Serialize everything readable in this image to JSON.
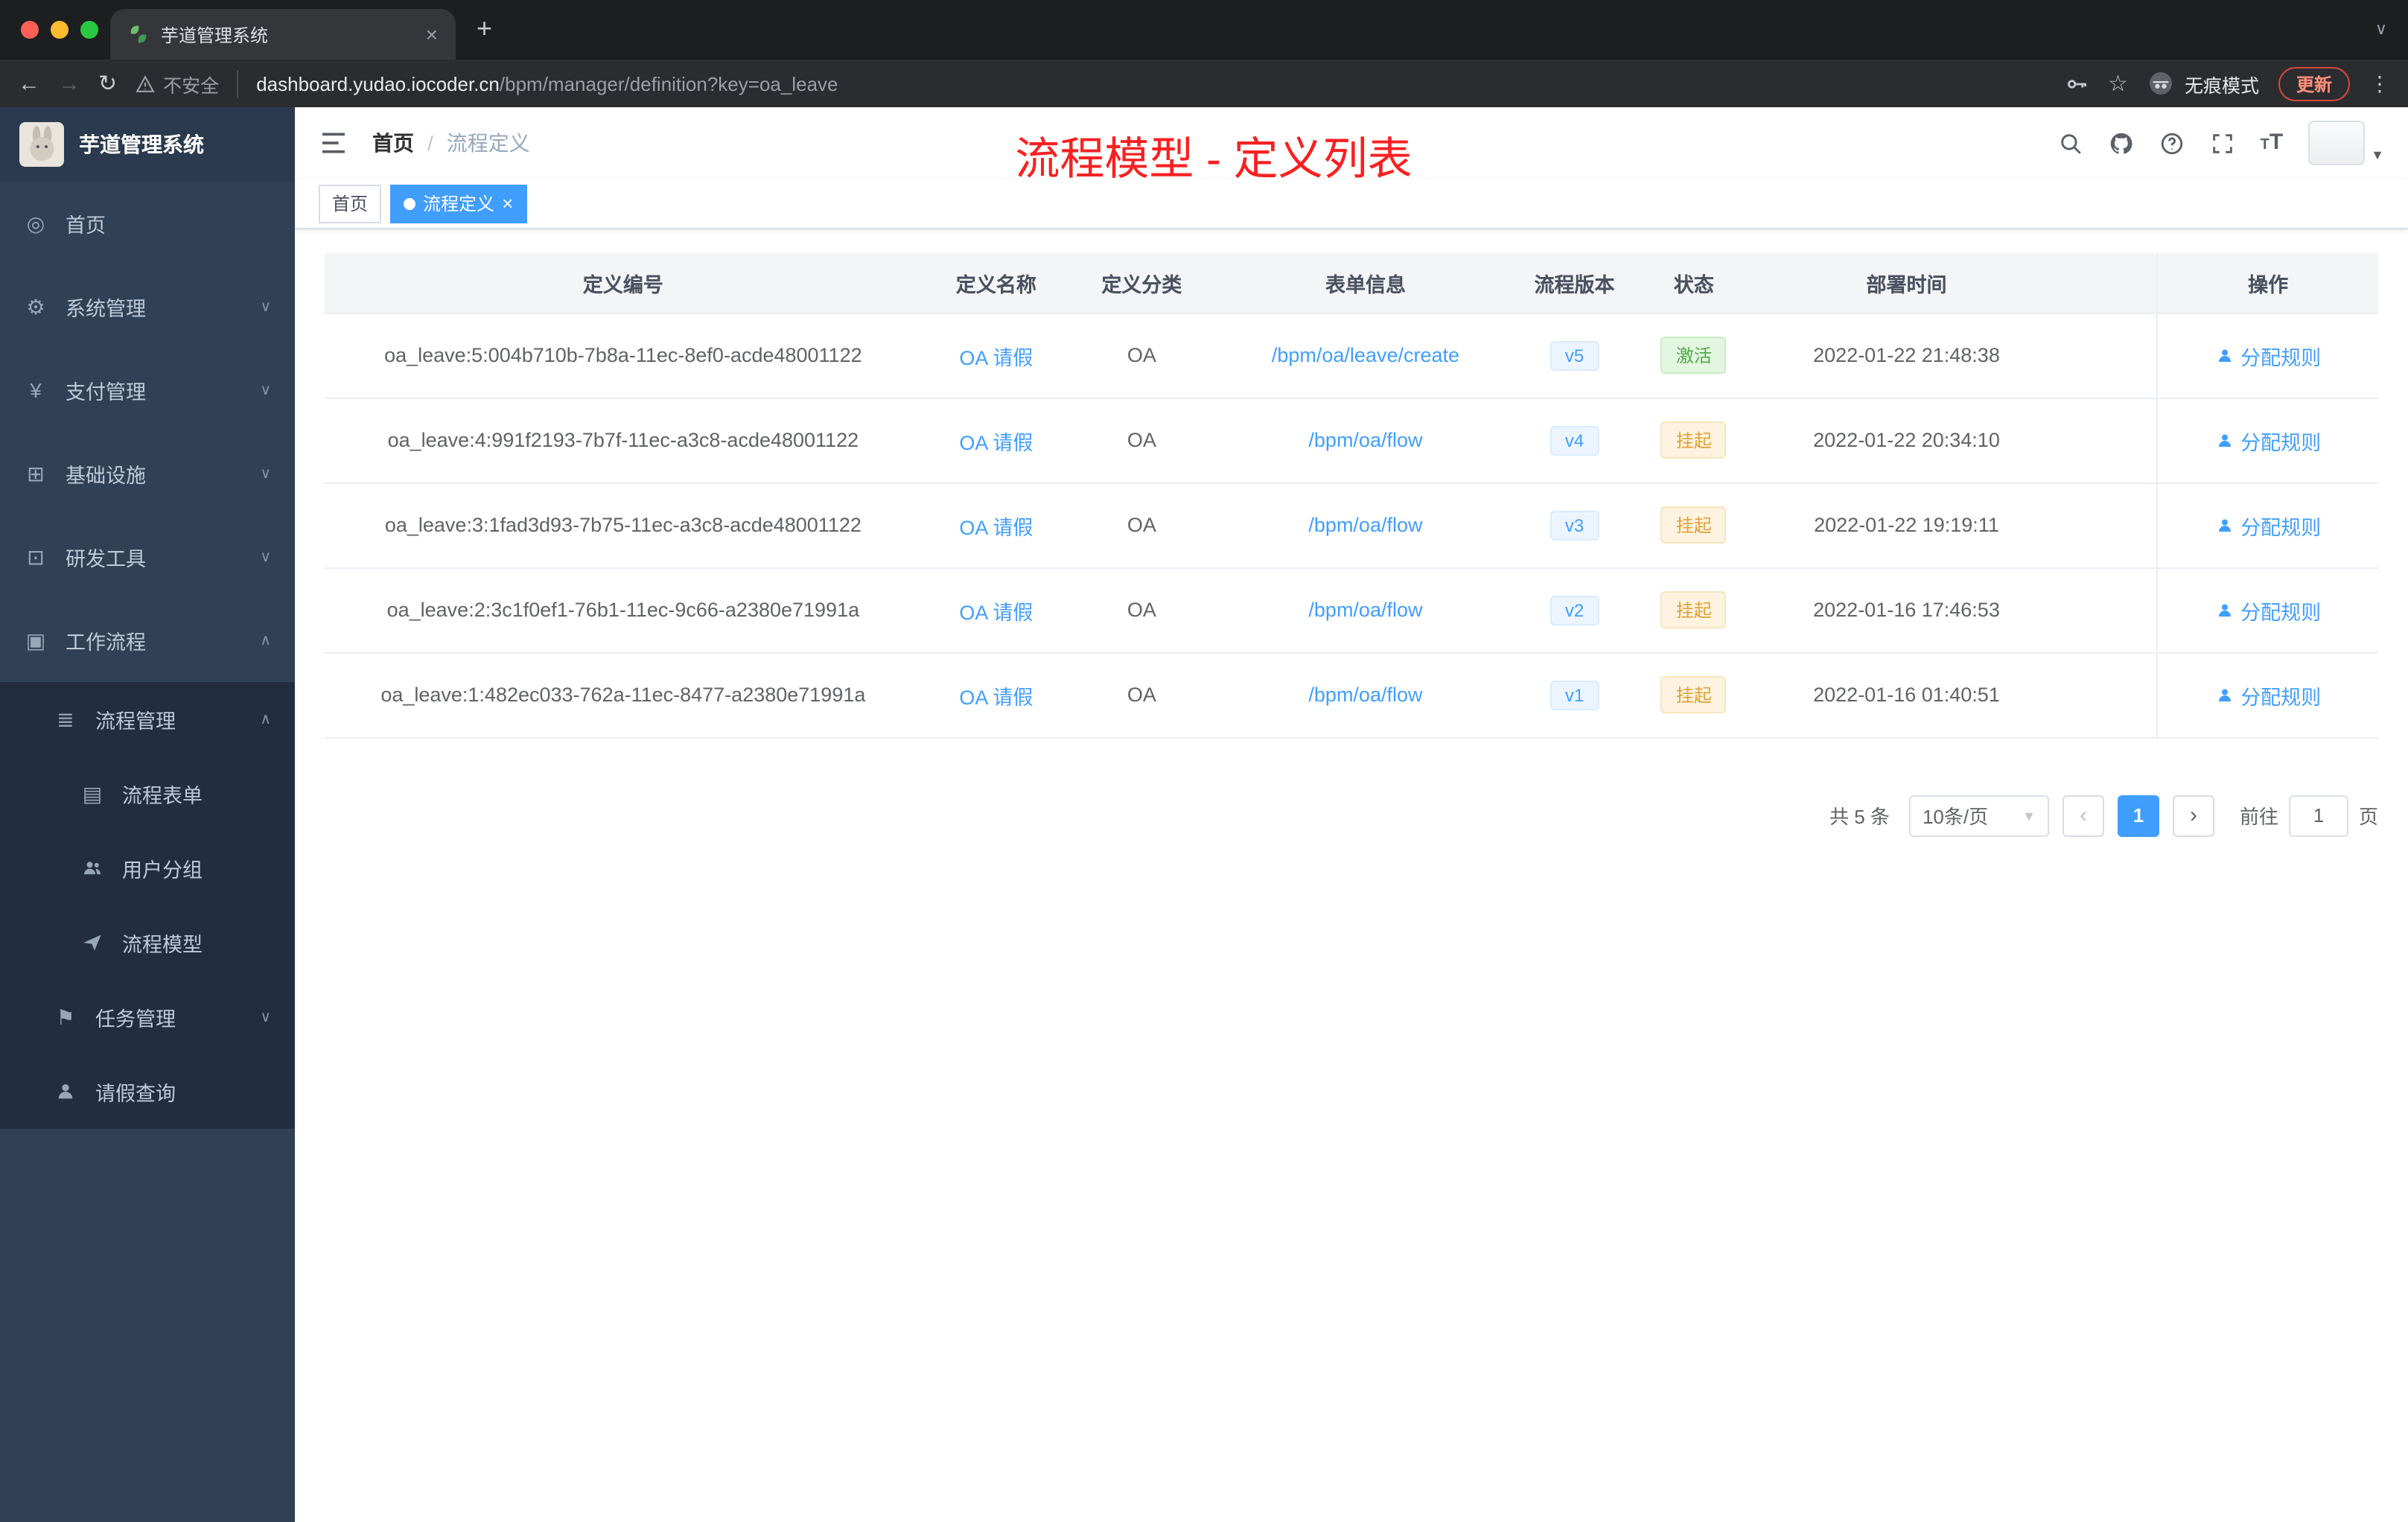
{
  "theme": {
    "accent": "#409eff",
    "success": "#51a94c",
    "warning": "#e0a23c",
    "annotation_red": "#fb2020",
    "sidebar_bg": "#304156",
    "submenu_bg": "#222d40"
  },
  "browser": {
    "tab": {
      "title": "芋道管理系统"
    },
    "nav": {
      "security_label": "不安全",
      "url_host": "dashboard.yudao.iocoder.cn",
      "url_path": "/bpm/manager/definition?key=oa_leave",
      "incognito_label": "无痕模式",
      "update_label": "更新"
    }
  },
  "sidebar": {
    "title": "芋道管理系统",
    "items": {
      "home": "首页",
      "system": "系统管理",
      "payment": "支付管理",
      "infra": "基础设施",
      "devtools": "研发工具",
      "workflow": "工作流程",
      "process_mgmt": "流程管理",
      "process_form": "流程表单",
      "user_group": "用户分组",
      "process_model": "流程模型",
      "task_mgmt": "任务管理",
      "leave_query": "请假查询"
    }
  },
  "header": {
    "breadcrumb_home": "首页",
    "breadcrumb_current": "流程定义",
    "annotation": "流程模型 - 定义列表"
  },
  "tags": {
    "home": "首页",
    "active": "流程定义"
  },
  "table": {
    "columns": [
      "定义编号",
      "定义名称",
      "定义分类",
      "表单信息",
      "流程版本",
      "状态",
      "部署时间",
      "操作"
    ],
    "rows": [
      {
        "id": "oa_leave:5:004b710b-7b8a-11ec-8ef0-acde48001122",
        "name": "OA 请假",
        "category": "OA",
        "form": "/bpm/oa/leave/create",
        "version": "v5",
        "status": "激活",
        "time": "2022-01-22 21:48:38",
        "action": "分配规则"
      },
      {
        "id": "oa_leave:4:991f2193-7b7f-11ec-a3c8-acde48001122",
        "name": "OA 请假",
        "category": "OA",
        "form": "/bpm/oa/flow",
        "version": "v4",
        "status": "挂起",
        "time": "2022-01-22 20:34:10",
        "action": "分配规则"
      },
      {
        "id": "oa_leave:3:1fad3d93-7b75-11ec-a3c8-acde48001122",
        "name": "OA 请假",
        "category": "OA",
        "form": "/bpm/oa/flow",
        "version": "v3",
        "status": "挂起",
        "time": "2022-01-22 19:19:11",
        "action": "分配规则"
      },
      {
        "id": "oa_leave:2:3c1f0ef1-76b1-11ec-9c66-a2380e71991a",
        "name": "OA 请假",
        "category": "OA",
        "form": "/bpm/oa/flow",
        "version": "v2",
        "status": "挂起",
        "time": "2022-01-16 17:46:53",
        "action": "分配规则"
      },
      {
        "id": "oa_leave:1:482ec033-762a-11ec-8477-a2380e71991a",
        "name": "OA 请假",
        "category": "OA",
        "form": "/bpm/oa/flow",
        "version": "v1",
        "status": "挂起",
        "time": "2022-01-16 01:40:51",
        "action": "分配规则"
      }
    ]
  },
  "pagination": {
    "total_label": "共 5 条",
    "page_size": "10条/页",
    "current_page": "1",
    "goto_label": "前往",
    "goto_value": "1",
    "goto_unit": "页"
  }
}
